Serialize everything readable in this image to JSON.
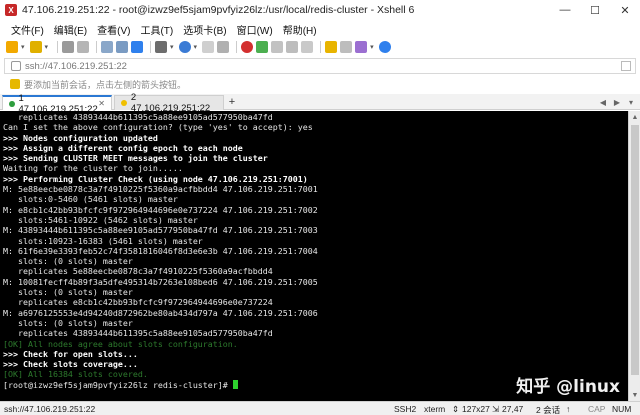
{
  "window": {
    "title": "47.106.219.251:22 - root@izwz9ef5sjam9pvfyiz26lz:/usr/local/redis-cluster - Xshell 6",
    "min_glyph": "—",
    "max_glyph": "☐",
    "close_glyph": "✕"
  },
  "menu": {
    "items": [
      "文件(F)",
      "编辑(E)",
      "查看(V)",
      "工具(T)",
      "选项卡(B)",
      "窗口(W)",
      "帮助(H)"
    ]
  },
  "address": {
    "text": "ssh://47.106.219.251:22"
  },
  "hint": {
    "text": "要添加当前会话，点击左侧的箭头按钮。"
  },
  "tabs": [
    {
      "label": "1 47.106.219.251:22",
      "active": true,
      "dot_color": "#2e9e3e"
    },
    {
      "label": "2 47.106.219.251:22",
      "active": false,
      "dot_color": "#f0c000"
    }
  ],
  "tab_add": "+",
  "tab_nav_left": "◀",
  "tab_nav_right": "▶",
  "tab_menu": "▾",
  "terminal": {
    "lines": [
      {
        "text": "   replicates 43893444b611395c5a88ee9105ad577950ba47fd",
        "style": "normal"
      },
      {
        "text": "Can I set the above configuration? (type 'yes' to accept): yes",
        "style": "normal"
      },
      {
        "text": ">>> Nodes configuration updated",
        "style": "bold"
      },
      {
        "text": ">>> Assign a different config epoch to each node",
        "style": "bold"
      },
      {
        "text": ">>> Sending CLUSTER MEET messages to join the cluster",
        "style": "bold"
      },
      {
        "text": "Waiting for the cluster to join.....",
        "style": "normal"
      },
      {
        "text": ">>> Performing Cluster Check (using node 47.106.219.251:7001)",
        "style": "bold"
      },
      {
        "text": "M: 5e88eecbe0878c3a7f4910225f5360a9acfbbdd4 47.106.219.251:7001",
        "style": "normal"
      },
      {
        "text": "   slots:0-5460 (5461 slots) master",
        "style": "normal"
      },
      {
        "text": "M: e8cb1c42bb93bfcfc9f972964944696e0e737224 47.106.219.251:7002",
        "style": "normal"
      },
      {
        "text": "   slots:5461-10922 (5462 slots) master",
        "style": "normal"
      },
      {
        "text": "M: 43893444b611395c5a88ee9105ad577950ba47fd 47.106.219.251:7003",
        "style": "normal"
      },
      {
        "text": "   slots:10923-16383 (5461 slots) master",
        "style": "normal"
      },
      {
        "text": "M: 61f6e39e3393feb52c74f3581816046f8d3e6e3b 47.106.219.251:7004",
        "style": "normal"
      },
      {
        "text": "   slots: (0 slots) master",
        "style": "normal"
      },
      {
        "text": "   replicates 5e88eecbe0878c3a7f4910225f5360a9acfbbdd4",
        "style": "normal"
      },
      {
        "text": "M: 10081fecff4b89f3a5dfe495314b7263e108bed6 47.106.219.251:7005",
        "style": "normal"
      },
      {
        "text": "   slots: (0 slots) master",
        "style": "normal"
      },
      {
        "text": "   replicates e8cb1c42bb93bfcfc9f972964944696e0e737224",
        "style": "normal"
      },
      {
        "text": "M: a6976125553e4d94240d872962be80ab434d797a 47.106.219.251:7006",
        "style": "normal"
      },
      {
        "text": "   slots: (0 slots) master",
        "style": "normal"
      },
      {
        "text": "   replicates 43893444b611395c5a88ee9105ad577950ba47fd",
        "style": "normal"
      },
      {
        "text": "[OK] All nodes agree about slots configuration.",
        "style": "dim"
      },
      {
        "text": ">>> Check for open slots...",
        "style": "bold"
      },
      {
        "text": ">>> Check slots coverage...",
        "style": "bold"
      },
      {
        "text": "[OK] All 16384 slots covered.",
        "style": "dim"
      },
      {
        "text": "[root@izwz9ef5sjam9pvfyiz26lz redis-cluster]# ",
        "style": "prompt"
      }
    ],
    "colors": {
      "background": "#000000",
      "text": "#e6e6e6",
      "ok": "#2d7a2d",
      "cursor": "#2ed12e"
    }
  },
  "watermark": "知乎 @linux",
  "status": {
    "address": "ssh://47.106.219.251:22",
    "protocol": "SSH2",
    "term": "xterm",
    "size": "127x27",
    "position": "27,47",
    "sessions": "2 会话",
    "cap": "CAP",
    "num": "NUM"
  }
}
